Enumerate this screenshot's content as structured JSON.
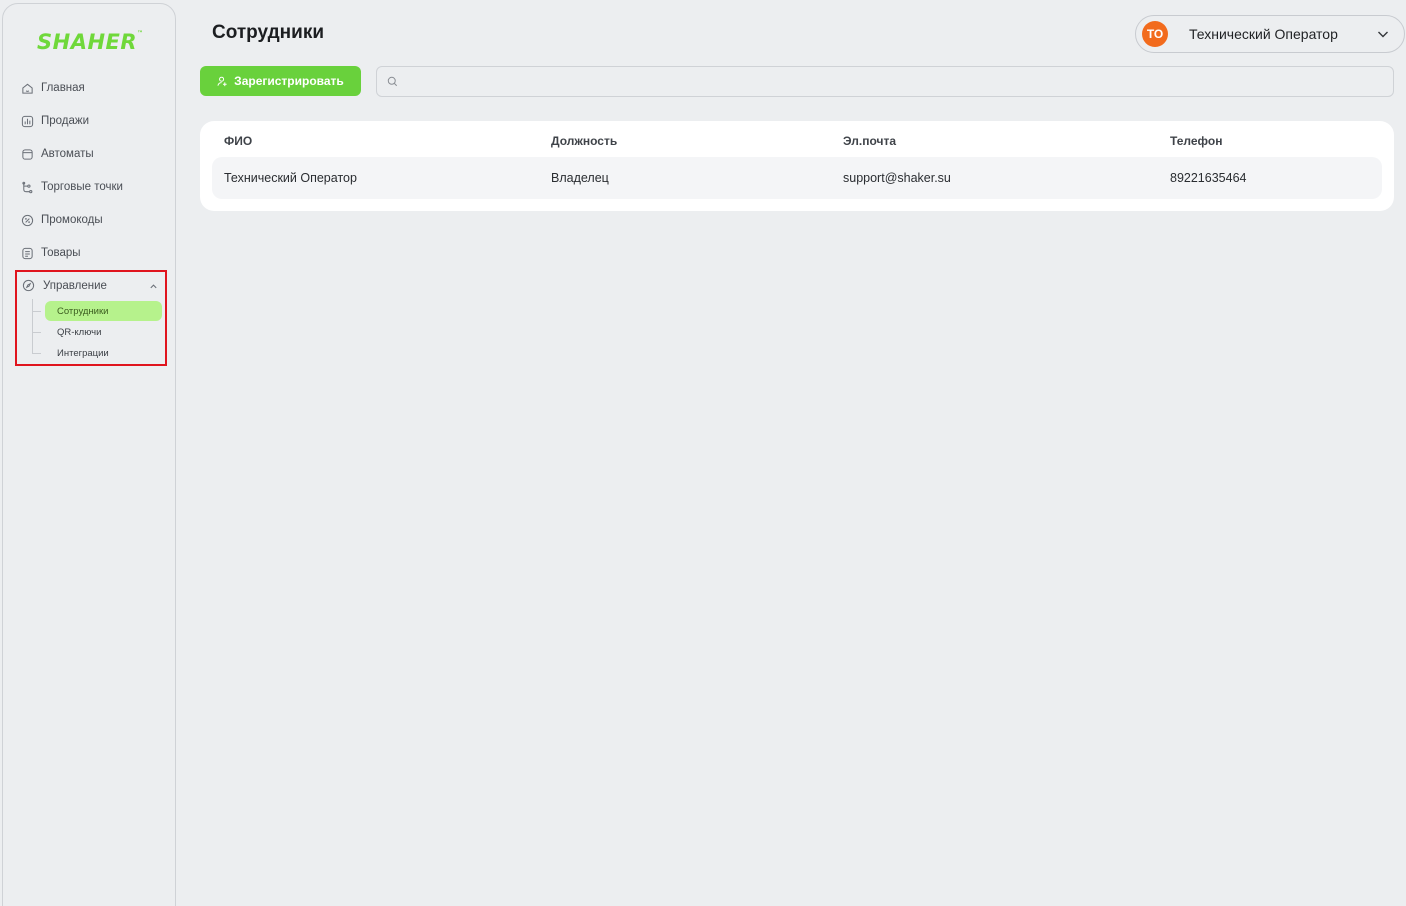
{
  "app": {
    "logo_text": "SHAHER",
    "logo_tm": "™"
  },
  "sidebar": {
    "items": [
      {
        "label": "Главная",
        "icon": "home-icon"
      },
      {
        "label": "Продажи",
        "icon": "chart-icon"
      },
      {
        "label": "Автоматы",
        "icon": "machine-icon"
      },
      {
        "label": "Торговые точки",
        "icon": "branch-icon"
      },
      {
        "label": "Промокоды",
        "icon": "tag-icon"
      },
      {
        "label": "Товары",
        "icon": "list-icon"
      }
    ],
    "management": {
      "label": "Управление",
      "icon": "compass-icon",
      "expanded": true,
      "children": [
        {
          "label": "Сотрудники",
          "active": true
        },
        {
          "label": "QR-ключи",
          "active": false
        },
        {
          "label": "Интеграции",
          "active": false
        }
      ]
    }
  },
  "header": {
    "title": "Сотрудники",
    "user": {
      "initials": "ТО",
      "name": "Технический Оператор"
    }
  },
  "toolbar": {
    "register_label": "Зарегистрировать",
    "search_placeholder": ""
  },
  "table": {
    "columns": [
      "ФИО",
      "Должность",
      "Эл.почта",
      "Телефон"
    ],
    "rows": [
      [
        "Технический Оператор",
        "Владелец",
        "support@shaker.su",
        "89221635464"
      ]
    ]
  },
  "colors": {
    "accent": "#69d13c",
    "active_bg": "#b6f28c",
    "avatar": "#f26b1d",
    "highlight": "#e0141e"
  }
}
